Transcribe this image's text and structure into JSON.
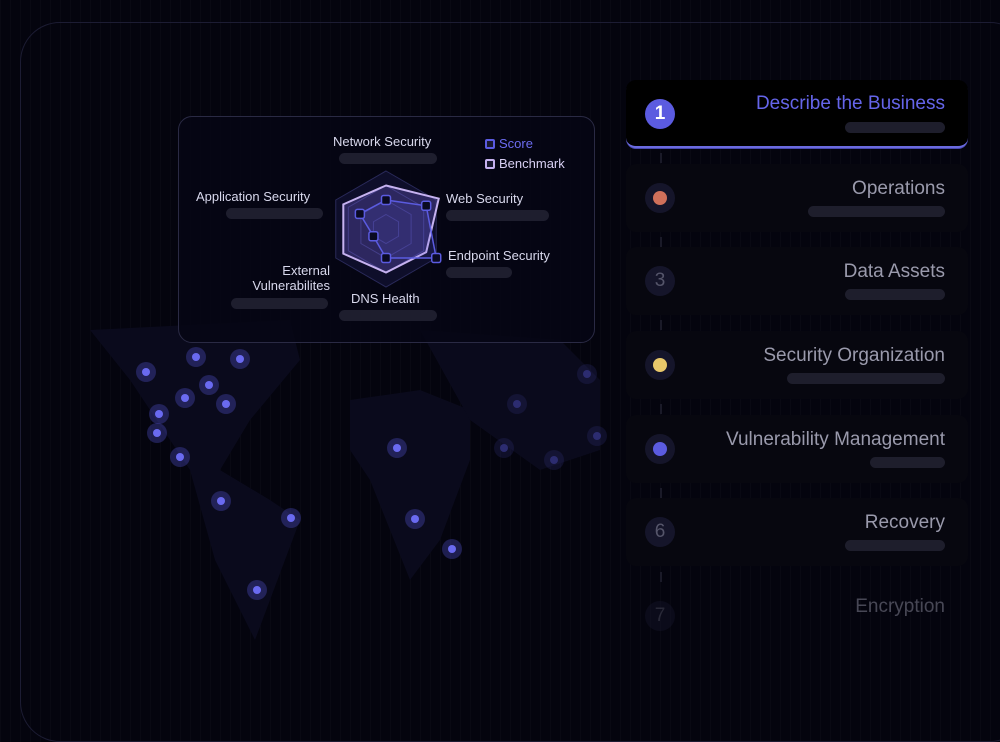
{
  "radar": {
    "axes": [
      "Network Security",
      "Web Security",
      "Endpoint Security",
      "DNS Health",
      "External Vulnerabilites",
      "Application Security"
    ],
    "external_line1": "External",
    "external_line2": "Vulnerabilites",
    "legend": {
      "score": "Score",
      "benchmark": "Benchmark"
    },
    "score": [
      0.5,
      0.8,
      1.0,
      0.5,
      0.25,
      0.52
    ],
    "benchmark": [
      0.75,
      1.05,
      0.8,
      0.75,
      0.85,
      0.85
    ],
    "colors": {
      "score": "#5b5be0",
      "benchmark": "#c6b2f0"
    }
  },
  "steps": [
    {
      "label": "Describe the Business",
      "marker": "1",
      "active": true,
      "color": "#5b5be0"
    },
    {
      "label": "Operations",
      "marker": "",
      "color": "#d0705a"
    },
    {
      "label": "Data Assets",
      "marker": "3"
    },
    {
      "label": "Security Organization",
      "marker": "",
      "color": "#e8c86a"
    },
    {
      "label": "Vulnerability Management",
      "marker": "",
      "color": "#5b5be0"
    },
    {
      "label": "Recovery",
      "marker": "6"
    },
    {
      "label": "Encryption",
      "marker": "7"
    }
  ]
}
